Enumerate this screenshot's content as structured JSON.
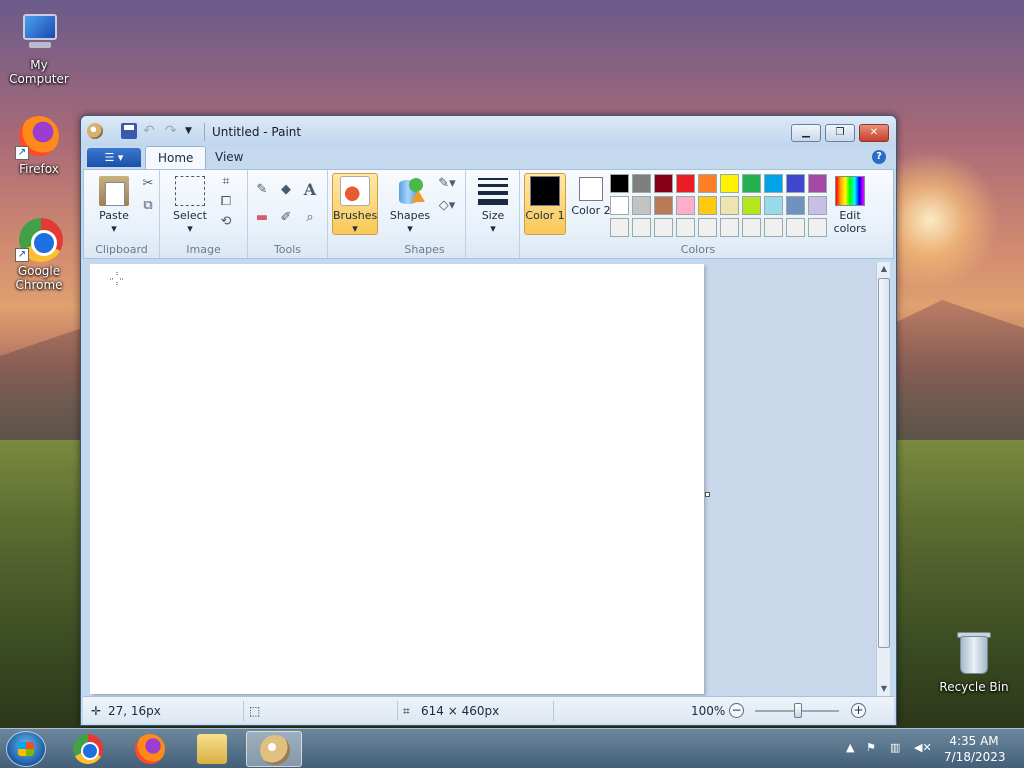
{
  "desktop": {
    "icons": [
      {
        "label": "My Computer",
        "icon": "computer-icon"
      },
      {
        "label": "Firefox",
        "icon": "firefox-icon"
      },
      {
        "label": "Google Chrome",
        "icon": "chrome-icon"
      },
      {
        "label": "Recycle Bin",
        "icon": "recycle-bin-icon"
      }
    ]
  },
  "window": {
    "title": "Untitled - Paint",
    "tabs": [
      "Home",
      "View"
    ],
    "ribbon": {
      "clipboard": {
        "paste": "Paste",
        "group": "Clipboard"
      },
      "image": {
        "select": "Select",
        "group": "Image"
      },
      "tools": {
        "group": "Tools",
        "text_glyph": "A"
      },
      "brushes": {
        "label": "Brushes"
      },
      "shapes": {
        "label": "Shapes",
        "group": "Shapes"
      },
      "size": {
        "label": "Size"
      },
      "colors": {
        "color1": "Color 1",
        "color2": "Color 2",
        "edit": "Edit colors",
        "group": "Colors",
        "color1_value": "#000000",
        "color2_value": "#ffffff",
        "palette_row1": [
          "#000000",
          "#7f7f7f",
          "#880015",
          "#ed1c24",
          "#ff7f27",
          "#fff200",
          "#22b14c",
          "#00a2e8",
          "#3f48cc",
          "#a349a4"
        ],
        "palette_row2": [
          "#ffffff",
          "#c3c3c3",
          "#b97a57",
          "#ffaec9",
          "#ffc90e",
          "#efe4b0",
          "#b5e61d",
          "#99d9ea",
          "#7092be",
          "#c8bfe7"
        ]
      }
    },
    "status": {
      "cursor_pos": "27, 16px",
      "canvas_size": "614 × 460px",
      "zoom": "100%"
    }
  },
  "taskbar": {
    "time": "4:35 AM",
    "date": "7/18/2023"
  }
}
